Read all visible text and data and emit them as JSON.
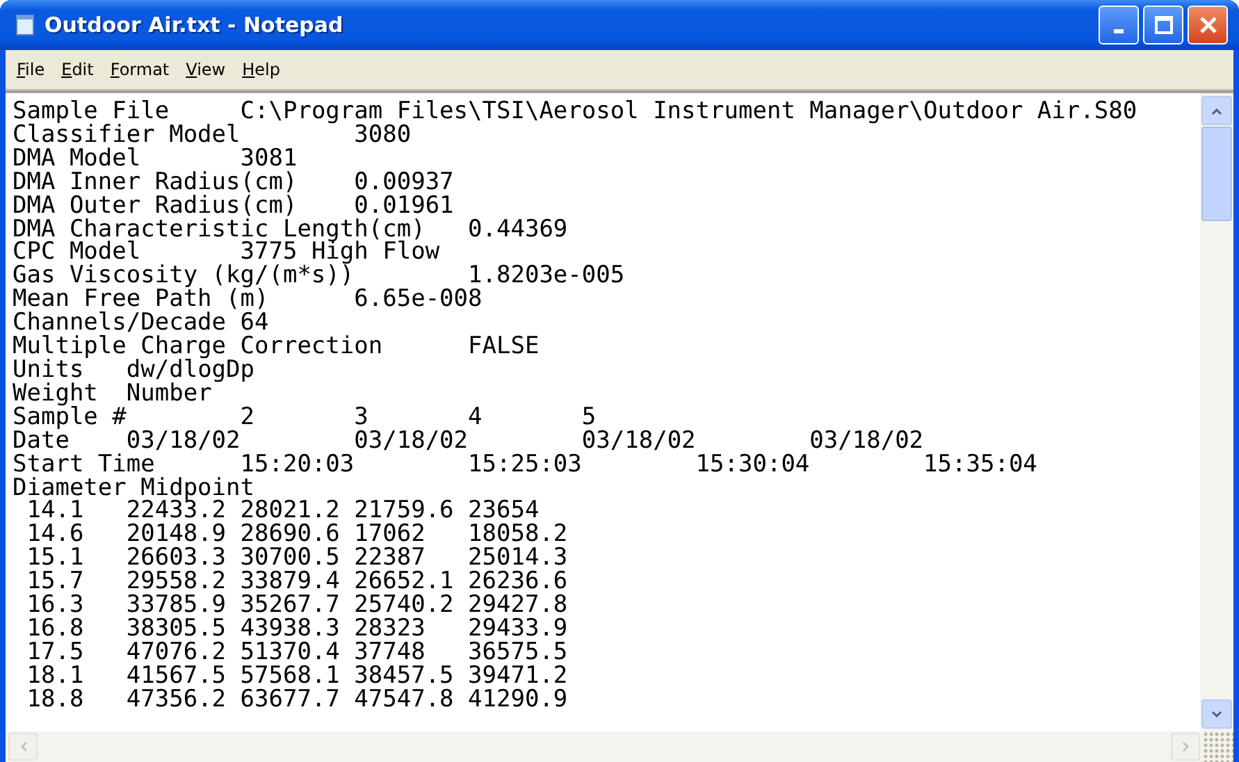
{
  "window": {
    "title": "Outdoor Air.txt - Notepad"
  },
  "menu": [
    {
      "label": "File"
    },
    {
      "label": "Edit"
    },
    {
      "label": "Format"
    },
    {
      "label": "View"
    },
    {
      "label": "Help"
    }
  ],
  "document": {
    "lines": [
      "Sample File\tC:\\Program Files\\TSI\\Aerosol Instrument Manager\\Outdoor Air.S80",
      "Classifier Model\t3080",
      "DMA Model\t3081",
      "DMA Inner Radius(cm)\t0.00937",
      "DMA Outer Radius(cm)\t0.01961",
      "DMA Characteristic Length(cm)\t0.44369",
      "CPC Model\t3775 High Flow",
      "Gas Viscosity (kg/(m*s))\t1.8203e-005",
      "Mean Free Path (m)\t6.65e-008",
      "Channels/Decade 64",
      "Multiple Charge Correction\tFALSE",
      "Units\tdw/dlogDp",
      "Weight\tNumber",
      "Sample #\t2\t3\t4\t5",
      "Date\t03/18/02\t03/18/02\t03/18/02\t03/18/02",
      "Start Time\t15:20:03\t15:25:03\t15:30:04\t15:35:04",
      "Diameter Midpoint",
      " 14.1\t22433.2\t28021.2\t21759.6\t23654",
      " 14.6\t20148.9\t28690.6\t17062\t18058.2",
      " 15.1\t26603.3\t30700.5\t22387\t25014.3",
      " 15.7\t29558.2\t33879.4\t26652.1\t26236.6",
      " 16.3\t33785.9\t35267.7\t25740.2\t29427.8",
      " 16.8\t38305.5\t43938.3\t28323\t29433.9",
      " 17.5\t47076.2\t51370.4\t37748\t36575.5",
      " 18.1\t41567.5\t57568.1\t38457.5\t39471.2",
      " 18.8\t47356.2\t63677.7\t47547.8\t41290.9"
    ]
  }
}
